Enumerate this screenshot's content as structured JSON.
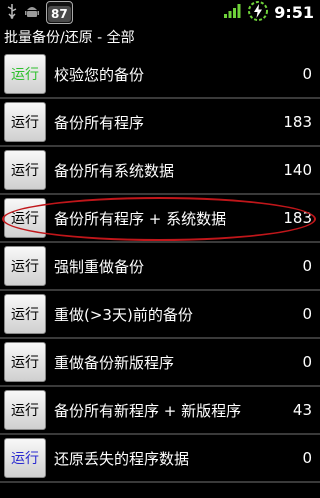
{
  "status": {
    "battery_badge": "87",
    "time": "9:51"
  },
  "header": {
    "title": "批量备份/还原 - 全部"
  },
  "rows": [
    {
      "button": "运行",
      "button_color": "#2ec02e",
      "label": "校验您的备份",
      "count": "0"
    },
    {
      "button": "运行",
      "button_color": "#000000",
      "label": "备份所有程序",
      "count": "183"
    },
    {
      "button": "运行",
      "button_color": "#000000",
      "label": "备份所有系统数据",
      "count": "140"
    },
    {
      "button": "运行",
      "button_color": "#000000",
      "label": "备份所有程序 + 系统数据",
      "count": "183"
    },
    {
      "button": "运行",
      "button_color": "#000000",
      "label": "强制重做备份",
      "count": "0"
    },
    {
      "button": "运行",
      "button_color": "#000000",
      "label": "重做(>3天)前的备份",
      "count": "0"
    },
    {
      "button": "运行",
      "button_color": "#000000",
      "label": "重做备份新版程序",
      "count": "0"
    },
    {
      "button": "运行",
      "button_color": "#000000",
      "label": "备份所有新程序 + 新版程序",
      "count": "43"
    },
    {
      "button": "运行",
      "button_color": "#2a2ad0",
      "label": "还原丢失的程序数据",
      "count": "0"
    }
  ],
  "colors": {
    "highlight_ellipse": "#c0161a"
  }
}
